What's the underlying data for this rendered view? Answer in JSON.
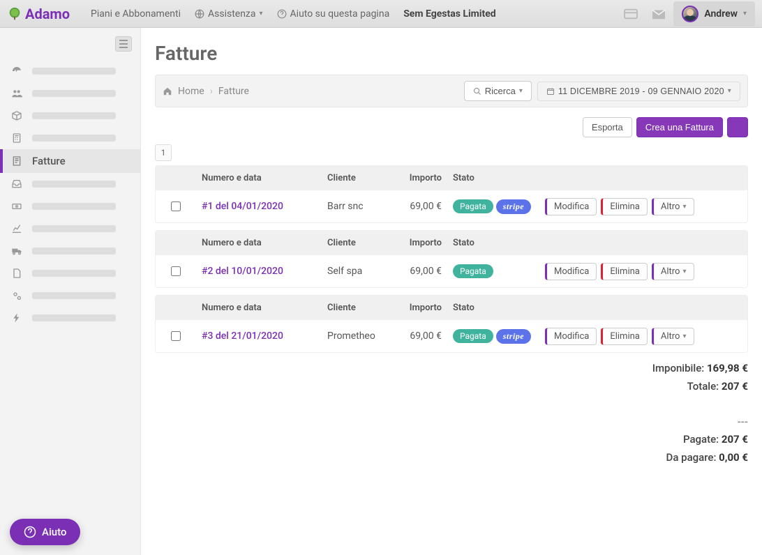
{
  "brand": "Adamo",
  "topnav": {
    "plans": "Piani e Abbonamenti",
    "assist": "Assistenza",
    "help_page": "Aiuto su questa pagina",
    "company": "Sem Egestas Limited"
  },
  "user": {
    "name": "Andrew"
  },
  "sidebar": {
    "active_label": "Fatture"
  },
  "page": {
    "title": "Fatture"
  },
  "breadcrumb": {
    "home": "Home",
    "current": "Fatture"
  },
  "toolbar": {
    "search": "Ricerca",
    "daterange": "11 DICEMBRE 2019 - 09 GENNAIO 2020"
  },
  "actions": {
    "export": "Esporta",
    "create": "Crea una Fattura"
  },
  "pagination": {
    "page": "1"
  },
  "columns": {
    "num": "Numero e data",
    "cli": "Cliente",
    "imp": "Importo",
    "stato": "Stato"
  },
  "status": {
    "paid": "Pagata",
    "stripe": "stripe"
  },
  "row_actions": {
    "edit": "Modifica",
    "del": "Elimina",
    "other": "Altro"
  },
  "rows": [
    {
      "num": "#1 del 04/01/2020",
      "cli": "Barr snc",
      "imp": "69,00 €",
      "stripe": true
    },
    {
      "num": "#2 del 10/01/2020",
      "cli": "Self spa",
      "imp": "69,00 €",
      "stripe": false
    },
    {
      "num": "#3 del 21/01/2020",
      "cli": "Prometheo",
      "imp": "69,00 €",
      "stripe": true
    }
  ],
  "totals": {
    "imponibile_label": "Imponibile:",
    "imponibile_val": "169,98 €",
    "totale_label": "Totale:",
    "totale_val": "207 €",
    "sep": "---",
    "pagate_label": "Pagate:",
    "pagate_val": "207 €",
    "dapagare_label": "Da pagare:",
    "dapagare_val": "0,00 €"
  },
  "help": "Aiuto"
}
